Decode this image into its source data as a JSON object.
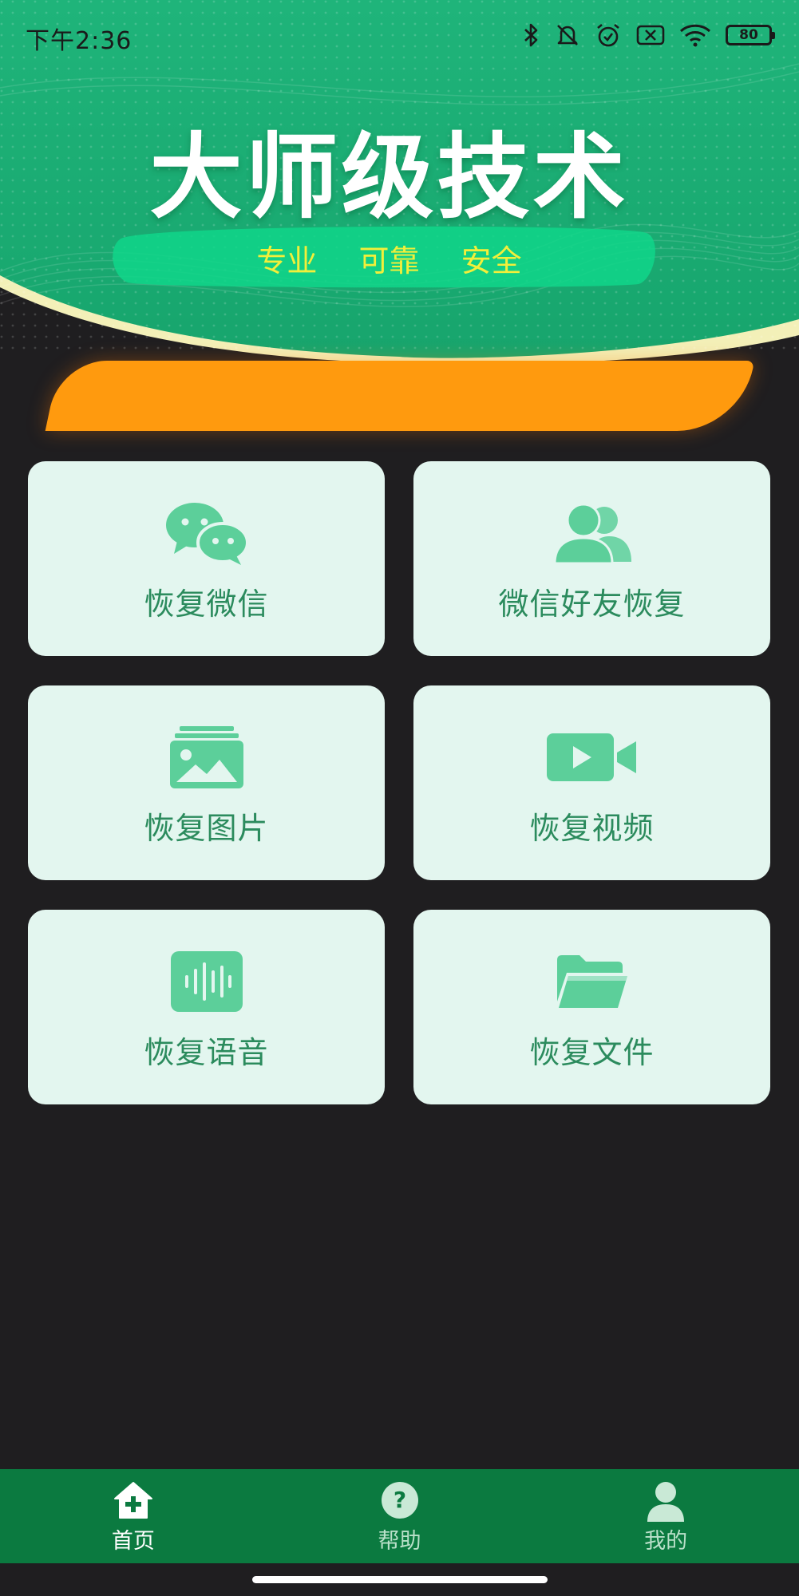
{
  "status_bar": {
    "time": "下午2:36",
    "battery": "80",
    "icons": [
      "bluetooth-icon",
      "mute-bell-icon",
      "alarm-icon",
      "sim-off-icon",
      "wifi-icon",
      "battery-icon"
    ]
  },
  "banner": {
    "title": "大师级技术",
    "subtitle": "专业 可靠 安全",
    "marquee_text": ""
  },
  "features": [
    {
      "label": "恢复微信",
      "icon": "wechat-icon"
    },
    {
      "label": "微信好友恢复",
      "icon": "friends-icon"
    },
    {
      "label": "恢复图片",
      "icon": "image-icon"
    },
    {
      "label": "恢复视频",
      "icon": "video-icon"
    },
    {
      "label": "恢复语音",
      "icon": "voice-icon"
    },
    {
      "label": "恢复文件",
      "icon": "folder-icon"
    }
  ],
  "bottom_nav": {
    "items": [
      {
        "label": "首页",
        "icon": "home-icon",
        "active": true
      },
      {
        "label": "帮助",
        "icon": "help-icon",
        "active": false
      },
      {
        "label": "我的",
        "icon": "profile-icon",
        "active": false
      }
    ]
  },
  "colors": {
    "banner_green": "#1fb47a",
    "card_bg": "#e3f6ef",
    "accent_green": "#2b8b5d",
    "icon_green": "#5ccf9a",
    "marquee_orange": "#ff9a0e",
    "nav_bg": "#0b7a40",
    "subtitle_yellow": "#f2ef3a",
    "page_bg": "#1f1e20"
  }
}
